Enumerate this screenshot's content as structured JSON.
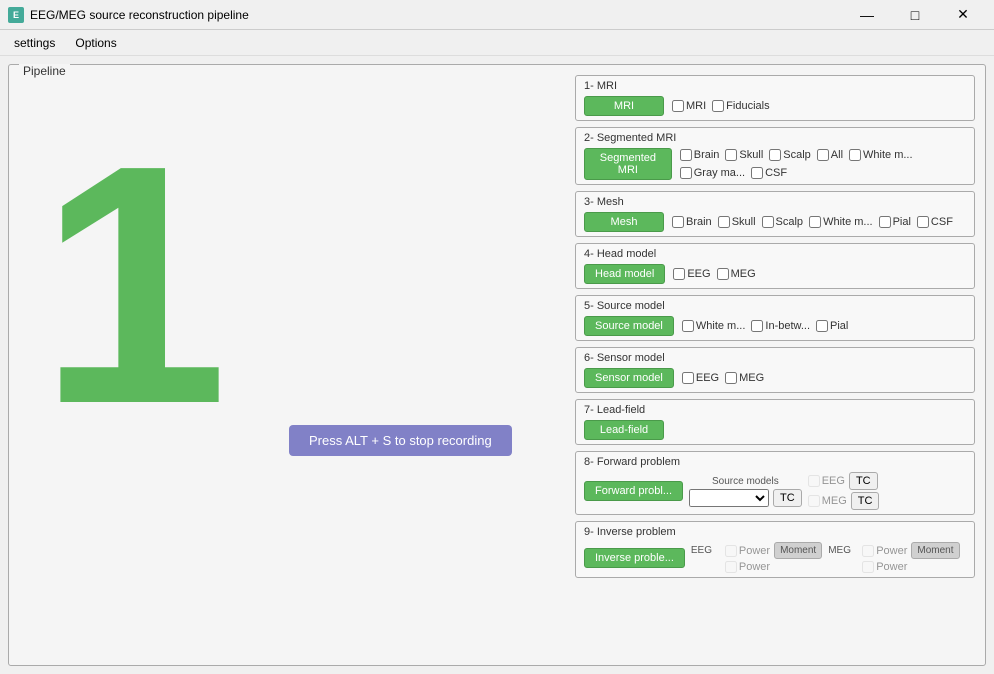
{
  "window": {
    "title": "EEG/MEG source reconstruction pipeline",
    "icon": "E"
  },
  "titleButtons": {
    "minimize": "—",
    "maximize": "□",
    "close": "✕"
  },
  "menuBar": {
    "items": [
      {
        "id": "settings",
        "label": "settings"
      },
      {
        "id": "options",
        "label": "Options"
      }
    ]
  },
  "pipeline": {
    "label": "Pipeline",
    "largeNumber": "1",
    "overlay": "Press ALT + S to stop recording",
    "steps": [
      {
        "id": "mri",
        "title": "1- MRI",
        "buttonLabel": "MRI",
        "checkboxes": [
          {
            "id": "mri-mri",
            "label": "MRI",
            "checked": false
          },
          {
            "id": "mri-fiducials",
            "label": "Fiducials",
            "checked": false
          }
        ]
      },
      {
        "id": "segmented-mri",
        "title": "2- Segmented MRI",
        "buttonLabel": "Segmented MRI",
        "checkboxes": [
          {
            "id": "seg-brain",
            "label": "Brain",
            "checked": false
          },
          {
            "id": "seg-skull",
            "label": "Skull",
            "checked": false
          },
          {
            "id": "seg-scalp",
            "label": "Scalp",
            "checked": false
          },
          {
            "id": "seg-all",
            "label": "All",
            "checked": false
          },
          {
            "id": "seg-white",
            "label": "White m...",
            "checked": false
          },
          {
            "id": "seg-gray",
            "label": "Gray ma...",
            "checked": false
          },
          {
            "id": "seg-csf",
            "label": "CSF",
            "checked": false
          }
        ]
      },
      {
        "id": "mesh",
        "title": "3- Mesh",
        "buttonLabel": "Mesh",
        "checkboxes": [
          {
            "id": "mesh-brain",
            "label": "Brain",
            "checked": false
          },
          {
            "id": "mesh-skull",
            "label": "Skull",
            "checked": false
          },
          {
            "id": "mesh-scalp",
            "label": "Scalp",
            "checked": false
          },
          {
            "id": "mesh-white",
            "label": "White m...",
            "checked": false
          },
          {
            "id": "mesh-pial",
            "label": "Pial",
            "checked": false
          },
          {
            "id": "mesh-csf",
            "label": "CSF",
            "checked": false
          }
        ]
      },
      {
        "id": "head-model",
        "title": "4- Head model",
        "buttonLabel": "Head model",
        "checkboxes": [
          {
            "id": "head-eeg",
            "label": "EEG",
            "checked": false
          },
          {
            "id": "head-meg",
            "label": "MEG",
            "checked": false
          }
        ]
      },
      {
        "id": "source-model",
        "title": "5- Source model",
        "buttonLabel": "Source model",
        "checkboxes": [
          {
            "id": "src-white",
            "label": "White m...",
            "checked": false
          },
          {
            "id": "src-inbetw",
            "label": "In-betw...",
            "checked": false
          },
          {
            "id": "src-pial",
            "label": "Pial",
            "checked": false
          }
        ]
      },
      {
        "id": "sensor-model",
        "title": "6- Sensor model",
        "buttonLabel": "Sensor model",
        "checkboxes": [
          {
            "id": "sensor-eeg",
            "label": "EEG",
            "checked": false
          },
          {
            "id": "sensor-meg",
            "label": "MEG",
            "checked": false
          }
        ]
      },
      {
        "id": "lead-field",
        "title": "7- Lead-field",
        "buttonLabel": "Lead-field",
        "checkboxes": []
      },
      {
        "id": "forward-problem",
        "title": "8- Forward problem",
        "buttonLabel": "Forward probl...",
        "special": "forward"
      },
      {
        "id": "inverse-problem",
        "title": "9- Inverse problem",
        "buttonLabel": "Inverse proble...",
        "special": "inverse"
      }
    ]
  }
}
